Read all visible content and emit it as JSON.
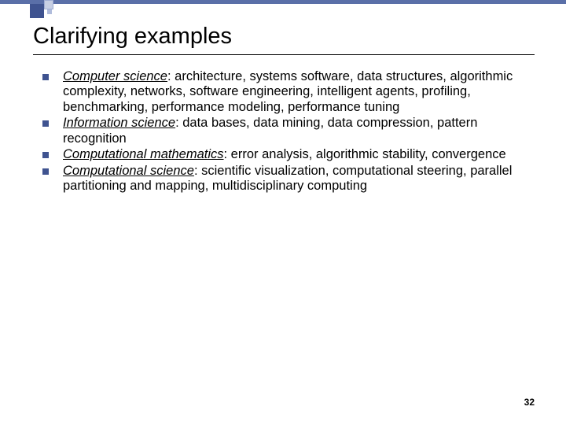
{
  "slide": {
    "title": "Clarifying examples",
    "page_number": "32",
    "bullets": [
      {
        "term": "Computer science",
        "rest": ": architecture, systems software, data structures, algorithmic complexity, networks, software engineering, intelligent agents, profiling, benchmarking, performance modeling, performance tuning"
      },
      {
        "term": "Information science",
        "rest": ": data bases, data mining, data compression, pattern recognition"
      },
      {
        "term": "Computational mathematics",
        "rest": ": error analysis, algorithmic stability, convergence"
      },
      {
        "term": "Computational science",
        "rest": ": scientific visualization, computational steering, parallel partitioning and mapping, multidisciplinary computing"
      }
    ]
  }
}
